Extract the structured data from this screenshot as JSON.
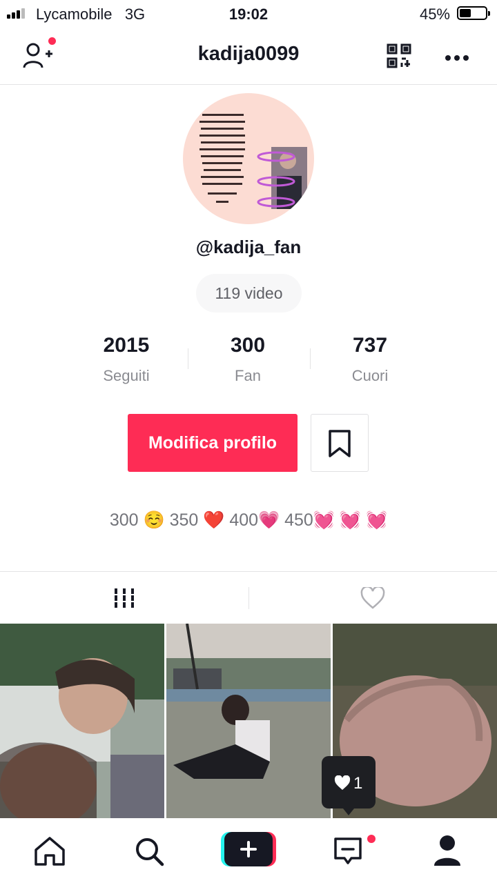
{
  "status_bar": {
    "carrier": "Lycamobile",
    "network": "3G",
    "time": "19:02",
    "battery_pct": "45%",
    "battery_level": 0.45
  },
  "header": {
    "username": "kadija0099",
    "add_friend_icon": "person-plus-icon",
    "qr_icon": "qr-code-icon",
    "more_icon": "more-horizontal-icon"
  },
  "profile": {
    "handle": "@kadija_fan",
    "videos_label": "119 video",
    "stats": [
      {
        "value": "2015",
        "label": "Seguiti"
      },
      {
        "value": "300",
        "label": "Fan"
      },
      {
        "value": "737",
        "label": "Cuori"
      }
    ],
    "edit_label": "Modifica profilo",
    "bio": "300 ☺️ 350 ❤️ 400💗 450💓 💓 💓"
  },
  "tabs": {
    "videos_icon": "grid-icon",
    "liked_icon": "heart-outline-icon"
  },
  "popup": {
    "likes": "1"
  },
  "colors": {
    "accent": "#fe2c55",
    "text": "#161823",
    "muted": "#8a8b91"
  },
  "nav": {
    "items": [
      "home-icon",
      "search-icon",
      "create-icon",
      "inbox-icon",
      "profile-icon"
    ]
  }
}
